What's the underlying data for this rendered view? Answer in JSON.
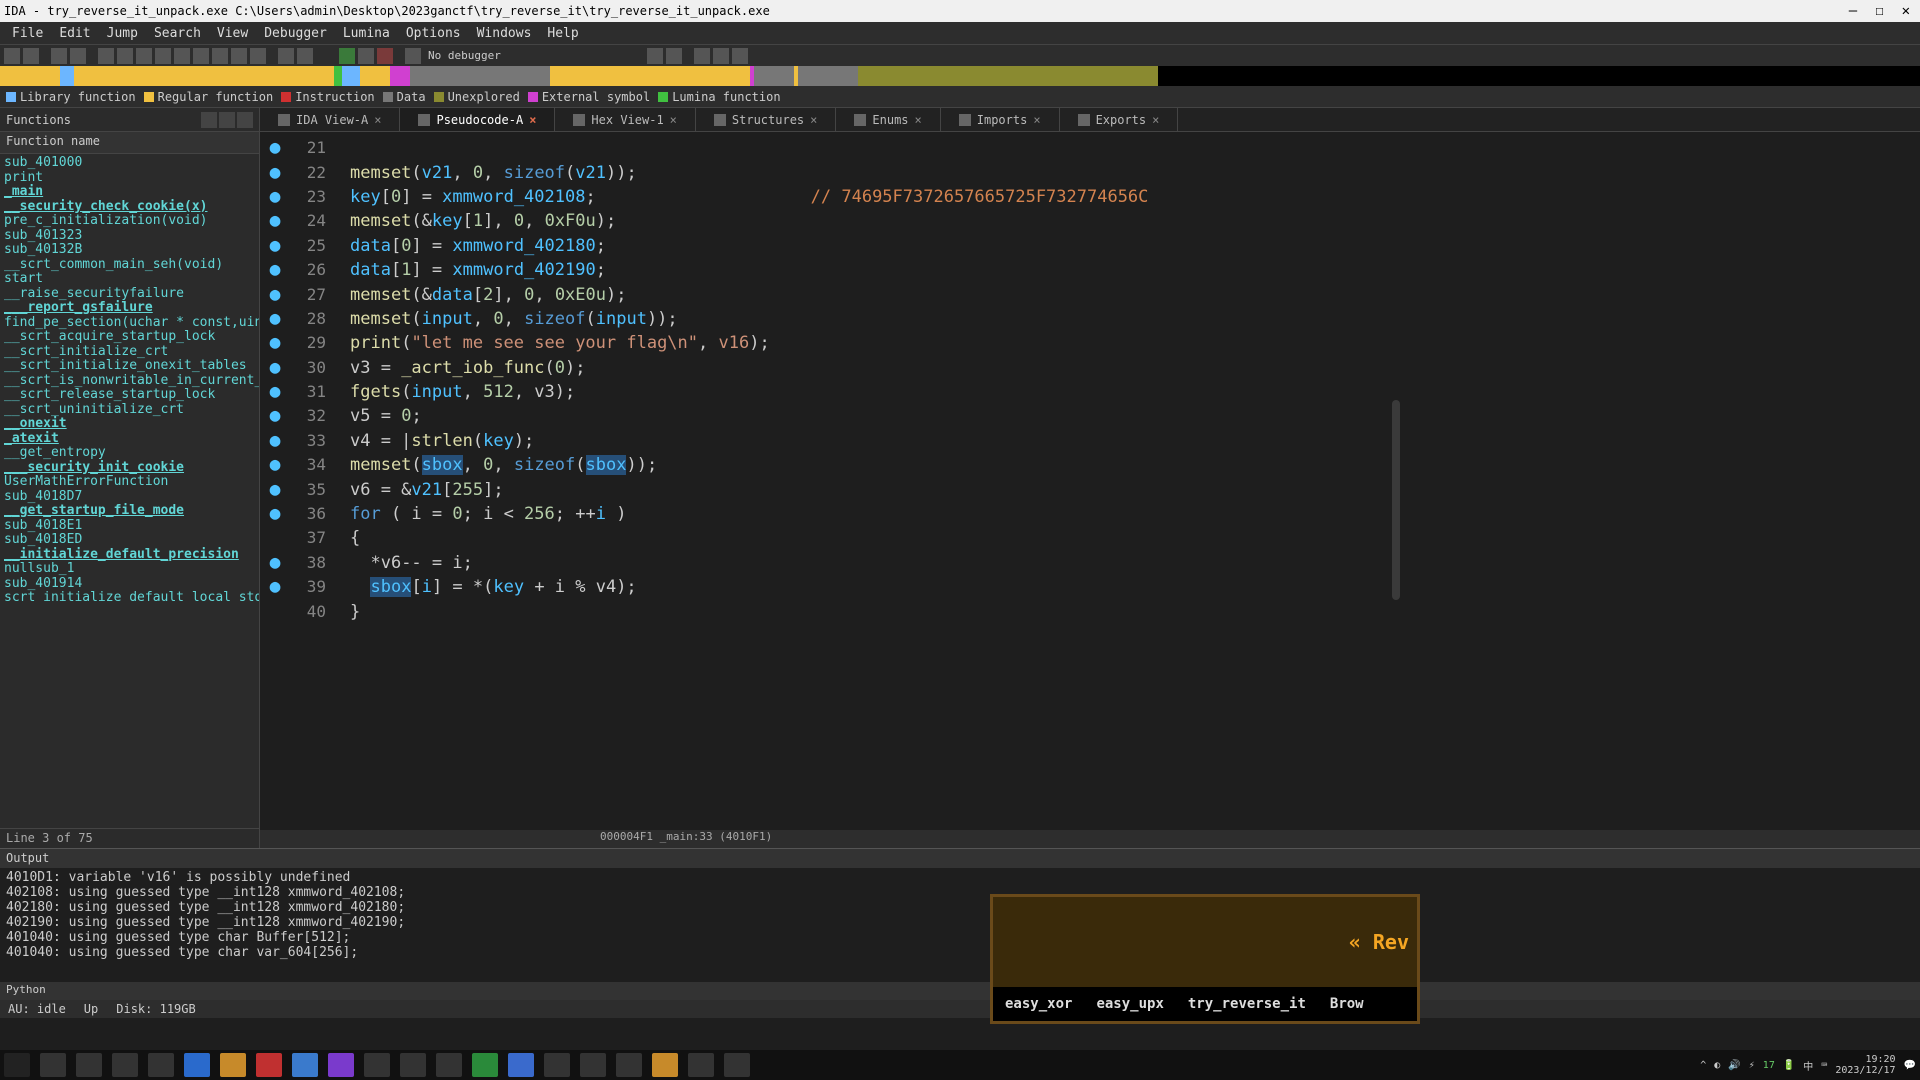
{
  "title": "IDA - try_reverse_it_unpack.exe C:\\Users\\admin\\Desktop\\2023ganctf\\try_reverse_it\\try_reverse_it_unpack.exe",
  "menu": [
    "File",
    "Edit",
    "Jump",
    "Search",
    "View",
    "Debugger",
    "Lumina",
    "Options",
    "Windows",
    "Help"
  ],
  "debugger": "No debugger",
  "legend": [
    {
      "c": "#6cb6ff",
      "l": "Library function"
    },
    {
      "c": "#f0c040",
      "l": "Regular function"
    },
    {
      "c": "#d03030",
      "l": "Instruction"
    },
    {
      "c": "#777",
      "l": "Data"
    },
    {
      "c": "#8a8a30",
      "l": "Unexplored"
    },
    {
      "c": "#d040d0",
      "l": "External symbol"
    },
    {
      "c": "#40c040",
      "l": "Lumina function"
    }
  ],
  "side_title": "Functions",
  "side_sub": "Function name",
  "functions": [
    {
      "n": "sub_401000"
    },
    {
      "n": "print"
    },
    {
      "n": "_main",
      "b": 1
    },
    {
      "n": "__security_check_cookie(x)",
      "b": 1
    },
    {
      "n": "pre_c_initialization(void)"
    },
    {
      "n": "sub_401323"
    },
    {
      "n": "sub_40132B"
    },
    {
      "n": "__scrt_common_main_seh(void)"
    },
    {
      "n": "start"
    },
    {
      "n": "__raise_securityfailure"
    },
    {
      "n": "___report_gsfailure",
      "b": 1
    },
    {
      "n": "find_pe_section(uchar * const,uint)"
    },
    {
      "n": "__scrt_acquire_startup_lock"
    },
    {
      "n": "__scrt_initialize_crt"
    },
    {
      "n": "__scrt_initialize_onexit_tables"
    },
    {
      "n": "__scrt_is_nonwritable_in_current_ima"
    },
    {
      "n": "__scrt_release_startup_lock"
    },
    {
      "n": "__scrt_uninitialize_crt"
    },
    {
      "n": "__onexit",
      "b": 1
    },
    {
      "n": "_atexit",
      "b": 1
    },
    {
      "n": "__get_entropy"
    },
    {
      "n": "___security_init_cookie",
      "b": 1
    },
    {
      "n": "UserMathErrorFunction"
    },
    {
      "n": "sub_4018D7"
    },
    {
      "n": "__get_startup_file_mode",
      "b": 1
    },
    {
      "n": "sub_4018E1"
    },
    {
      "n": "sub_4018ED"
    },
    {
      "n": "__initialize_default_precision",
      "b": 1
    },
    {
      "n": "nullsub_1"
    },
    {
      "n": "sub_401914"
    },
    {
      "n": "  scrt initialize default local stdi"
    }
  ],
  "side_foot": "Line 3 of 75",
  "tabs": [
    {
      "l": "IDA View-A",
      "x": "×"
    },
    {
      "l": "Pseudocode-A",
      "x": "×",
      "active": true,
      "red": true
    },
    {
      "l": "Hex View-1",
      "x": "×"
    },
    {
      "l": "Structures",
      "x": "×"
    },
    {
      "l": "Enums",
      "x": "×"
    },
    {
      "l": "Imports",
      "x": "×"
    },
    {
      "l": "Exports",
      "x": "×"
    }
  ],
  "code": [
    {
      "n": 21,
      "bp": 1,
      "h": ""
    },
    {
      "n": 22,
      "bp": 1,
      "h": "<span class='fn'>memset</span><span class='op'>(</span><span class='id'>v21</span><span class='op'>, </span><span class='num'>0</span><span class='op'>, </span><span class='kw'>sizeof</span><span class='op'>(</span><span class='id'>v21</span><span class='op'>));</span>"
    },
    {
      "n": 23,
      "bp": 1,
      "h": "<span class='id'>key</span><span class='op'>[</span><span class='num'>0</span><span class='op'>] = </span><span class='id'>xmmword_402108</span><span class='op'>;</span>                     <span class='cm'>// 74695F7372657665725F732774656C</span>"
    },
    {
      "n": 24,
      "bp": 1,
      "h": "<span class='fn'>memset</span><span class='op'>(&amp;</span><span class='id'>key</span><span class='op'>[</span><span class='num'>1</span><span class='op'>], </span><span class='num'>0</span><span class='op'>, </span><span class='num'>0xF0u</span><span class='op'>);</span>"
    },
    {
      "n": 25,
      "bp": 1,
      "h": "<span class='id'>data</span><span class='op'>[</span><span class='num'>0</span><span class='op'>] = </span><span class='id'>xmmword_402180</span><span class='op'>;</span>"
    },
    {
      "n": 26,
      "bp": 1,
      "h": "<span class='id'>data</span><span class='op'>[</span><span class='num'>1</span><span class='op'>] = </span><span class='id'>xmmword_402190</span><span class='op'>;</span>"
    },
    {
      "n": 27,
      "bp": 1,
      "h": "<span class='fn'>memset</span><span class='op'>(&amp;</span><span class='id'>data</span><span class='op'>[</span><span class='num'>2</span><span class='op'>], </span><span class='num'>0</span><span class='op'>, </span><span class='num'>0xE0u</span><span class='op'>);</span>"
    },
    {
      "n": 28,
      "bp": 1,
      "h": "<span class='fn'>memset</span><span class='op'>(</span><span class='id'>input</span><span class='op'>, </span><span class='num'>0</span><span class='op'>, </span><span class='kw'>sizeof</span><span class='op'>(</span><span class='id'>input</span><span class='op'>));</span>"
    },
    {
      "n": 29,
      "bp": 1,
      "h": "<span class='fn'>print</span><span class='op'>(</span><span class='str'>\"let me see see your flag\\n\"</span><span class='op'>, </span><span class='id' style='color:#ce9178'>v16</span><span class='op'>);</span>"
    },
    {
      "n": 30,
      "bp": 1,
      "h": "<span class='op'>v3 = </span><span class='fn'>_acrt_iob_func</span><span class='op'>(</span><span class='num'>0</span><span class='op'>);</span>"
    },
    {
      "n": 31,
      "bp": 1,
      "h": "<span class='fn'>fgets</span><span class='op'>(</span><span class='id'>input</span><span class='op'>, </span><span class='num'>512</span><span class='op'>, v3);</span>"
    },
    {
      "n": 32,
      "bp": 1,
      "h": "<span class='op'>v5 = </span><span class='num'>0</span><span class='op'>;</span>"
    },
    {
      "n": 33,
      "bp": 1,
      "h": "<span class='op'>v4 = |</span><span class='fn'>strlen</span><span class='op'>(</span><span class='id'>key</span><span class='op'>);</span>"
    },
    {
      "n": 34,
      "bp": 1,
      "h": "<span class='fn'>memset</span><span class='op'>(</span><span class='idh'>sbox</span><span class='op'>, </span><span class='num'>0</span><span class='op'>, </span><span class='kw'>sizeof</span><span class='op'>(</span><span class='idh'>sbox</span><span class='op'>));</span>"
    },
    {
      "n": 35,
      "bp": 1,
      "h": "<span class='op'>v6 = &amp;</span><span class='id'>v21</span><span class='op'>[</span><span class='num'>255</span><span class='op'>];</span>"
    },
    {
      "n": 36,
      "bp": 1,
      "h": "<span class='kw'>for</span><span class='op'> ( i = </span><span class='num'>0</span><span class='op'>; i &lt; </span><span class='num'>256</span><span class='op'>; ++</span><span class='id'>i</span><span class='op'> )</span>"
    },
    {
      "n": 37,
      "bp": 0,
      "h": "<span class='op'>{</span>"
    },
    {
      "n": 38,
      "bp": 1,
      "h": "  <span class='op'>*v6-- = i;</span>"
    },
    {
      "n": 39,
      "bp": 1,
      "h": "  <span class='idh'>sbox</span><span class='op'>[</span><span class='id'>i</span><span class='op'>] = *(</span><span class='id'>key</span><span class='op'> + i % v4);</span>"
    },
    {
      "n": 40,
      "bp": 0,
      "h": "<span class='op'>}</span>"
    }
  ],
  "status_line": "000004F1 _main:33 (4010F1)",
  "out_title": "Output",
  "output": [
    "4010D1: variable 'v16' is possibly undefined",
    "402108: using guessed type __int128 xmmword_402108;",
    "402180: using guessed type __int128 xmmword_402180;",
    "402190: using guessed type __int128 xmmword_402190;",
    "401040: using guessed type char Buffer[512];",
    "401040: using guessed type char var_604[256];"
  ],
  "python": "Python",
  "sbar": {
    "idle": "AU: idle",
    "up": "Up",
    "disk": "Disk: 119GB"
  },
  "popup": {
    "title": "« Rev",
    "tabs": [
      "easy_xor",
      "easy_upx",
      "try_reverse_it",
      "Brow"
    ]
  },
  "clock": {
    "t": "19:20",
    "d": "2023/12/17"
  }
}
